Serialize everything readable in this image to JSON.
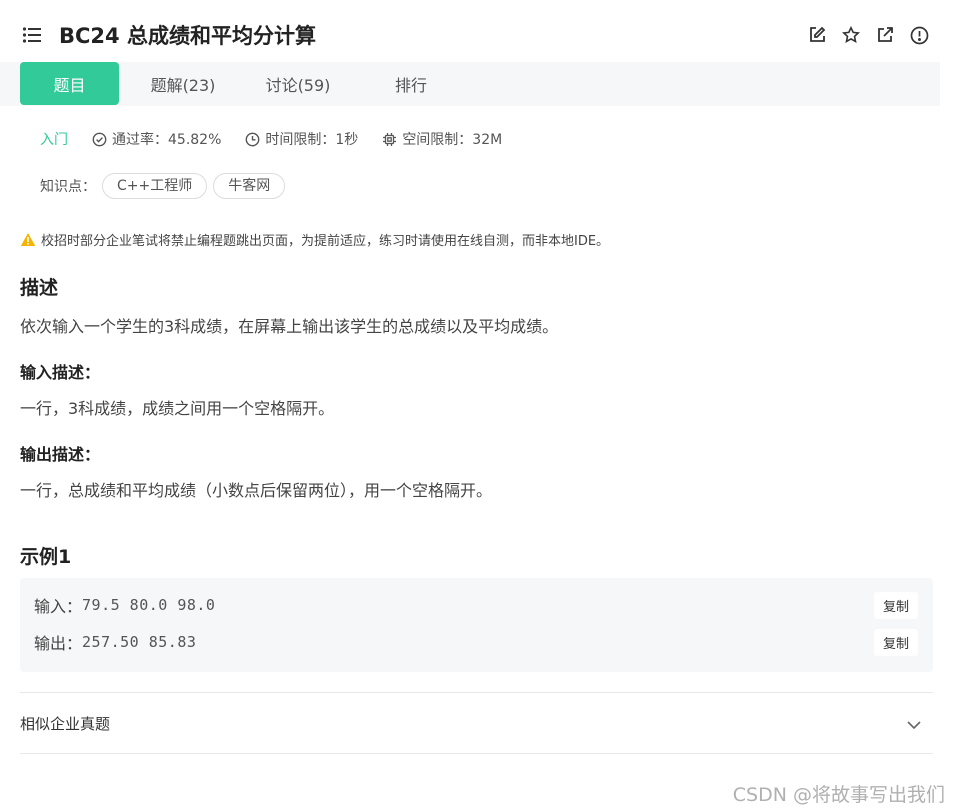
{
  "header": {
    "title": "BC24  总成绩和平均分计算",
    "icons": [
      "list-icon",
      "edit-icon",
      "star-icon",
      "share-icon",
      "info-icon"
    ]
  },
  "tabs": [
    {
      "label": "题目",
      "active": true
    },
    {
      "label": "题解(23)",
      "active": false
    },
    {
      "label": "讨论(59)",
      "active": false
    },
    {
      "label": "排行",
      "active": false
    }
  ],
  "meta": {
    "level": "入门",
    "pass_rate": "通过率：45.82%",
    "time_limit": "时间限制：1秒",
    "space_limit": "空间限制：32M"
  },
  "knowledge": {
    "label": "知识点：",
    "tags": [
      "C++工程师",
      "牛客网"
    ]
  },
  "notice": "校招时部分企业笔试将禁止编程题跳出页面，为提前适应，练习时请使用在线自测，而非本地IDE。",
  "description": {
    "heading": "描述",
    "text": "依次输入一个学生的3科成绩，在屏幕上输出该学生的总成绩以及平均成绩。"
  },
  "input_desc": {
    "heading": "输入描述：",
    "text": "一行，3科成绩，成绩之间用一个空格隔开。"
  },
  "output_desc": {
    "heading": "输出描述：",
    "text": "一行，总成绩和平均成绩（小数点后保留两位），用一个空格隔开。"
  },
  "example": {
    "heading": "示例1",
    "input_label": "输入：",
    "input_value": "79.5 80.0 98.0",
    "output_label": "输出：",
    "output_value": "257.50 85.83",
    "copy_label": "复制"
  },
  "similar": {
    "label": "相似企业真题"
  },
  "watermark": "CSDN @将故事写出我们",
  "colors": {
    "accent": "#32ca99",
    "warning": "#f5b400"
  }
}
